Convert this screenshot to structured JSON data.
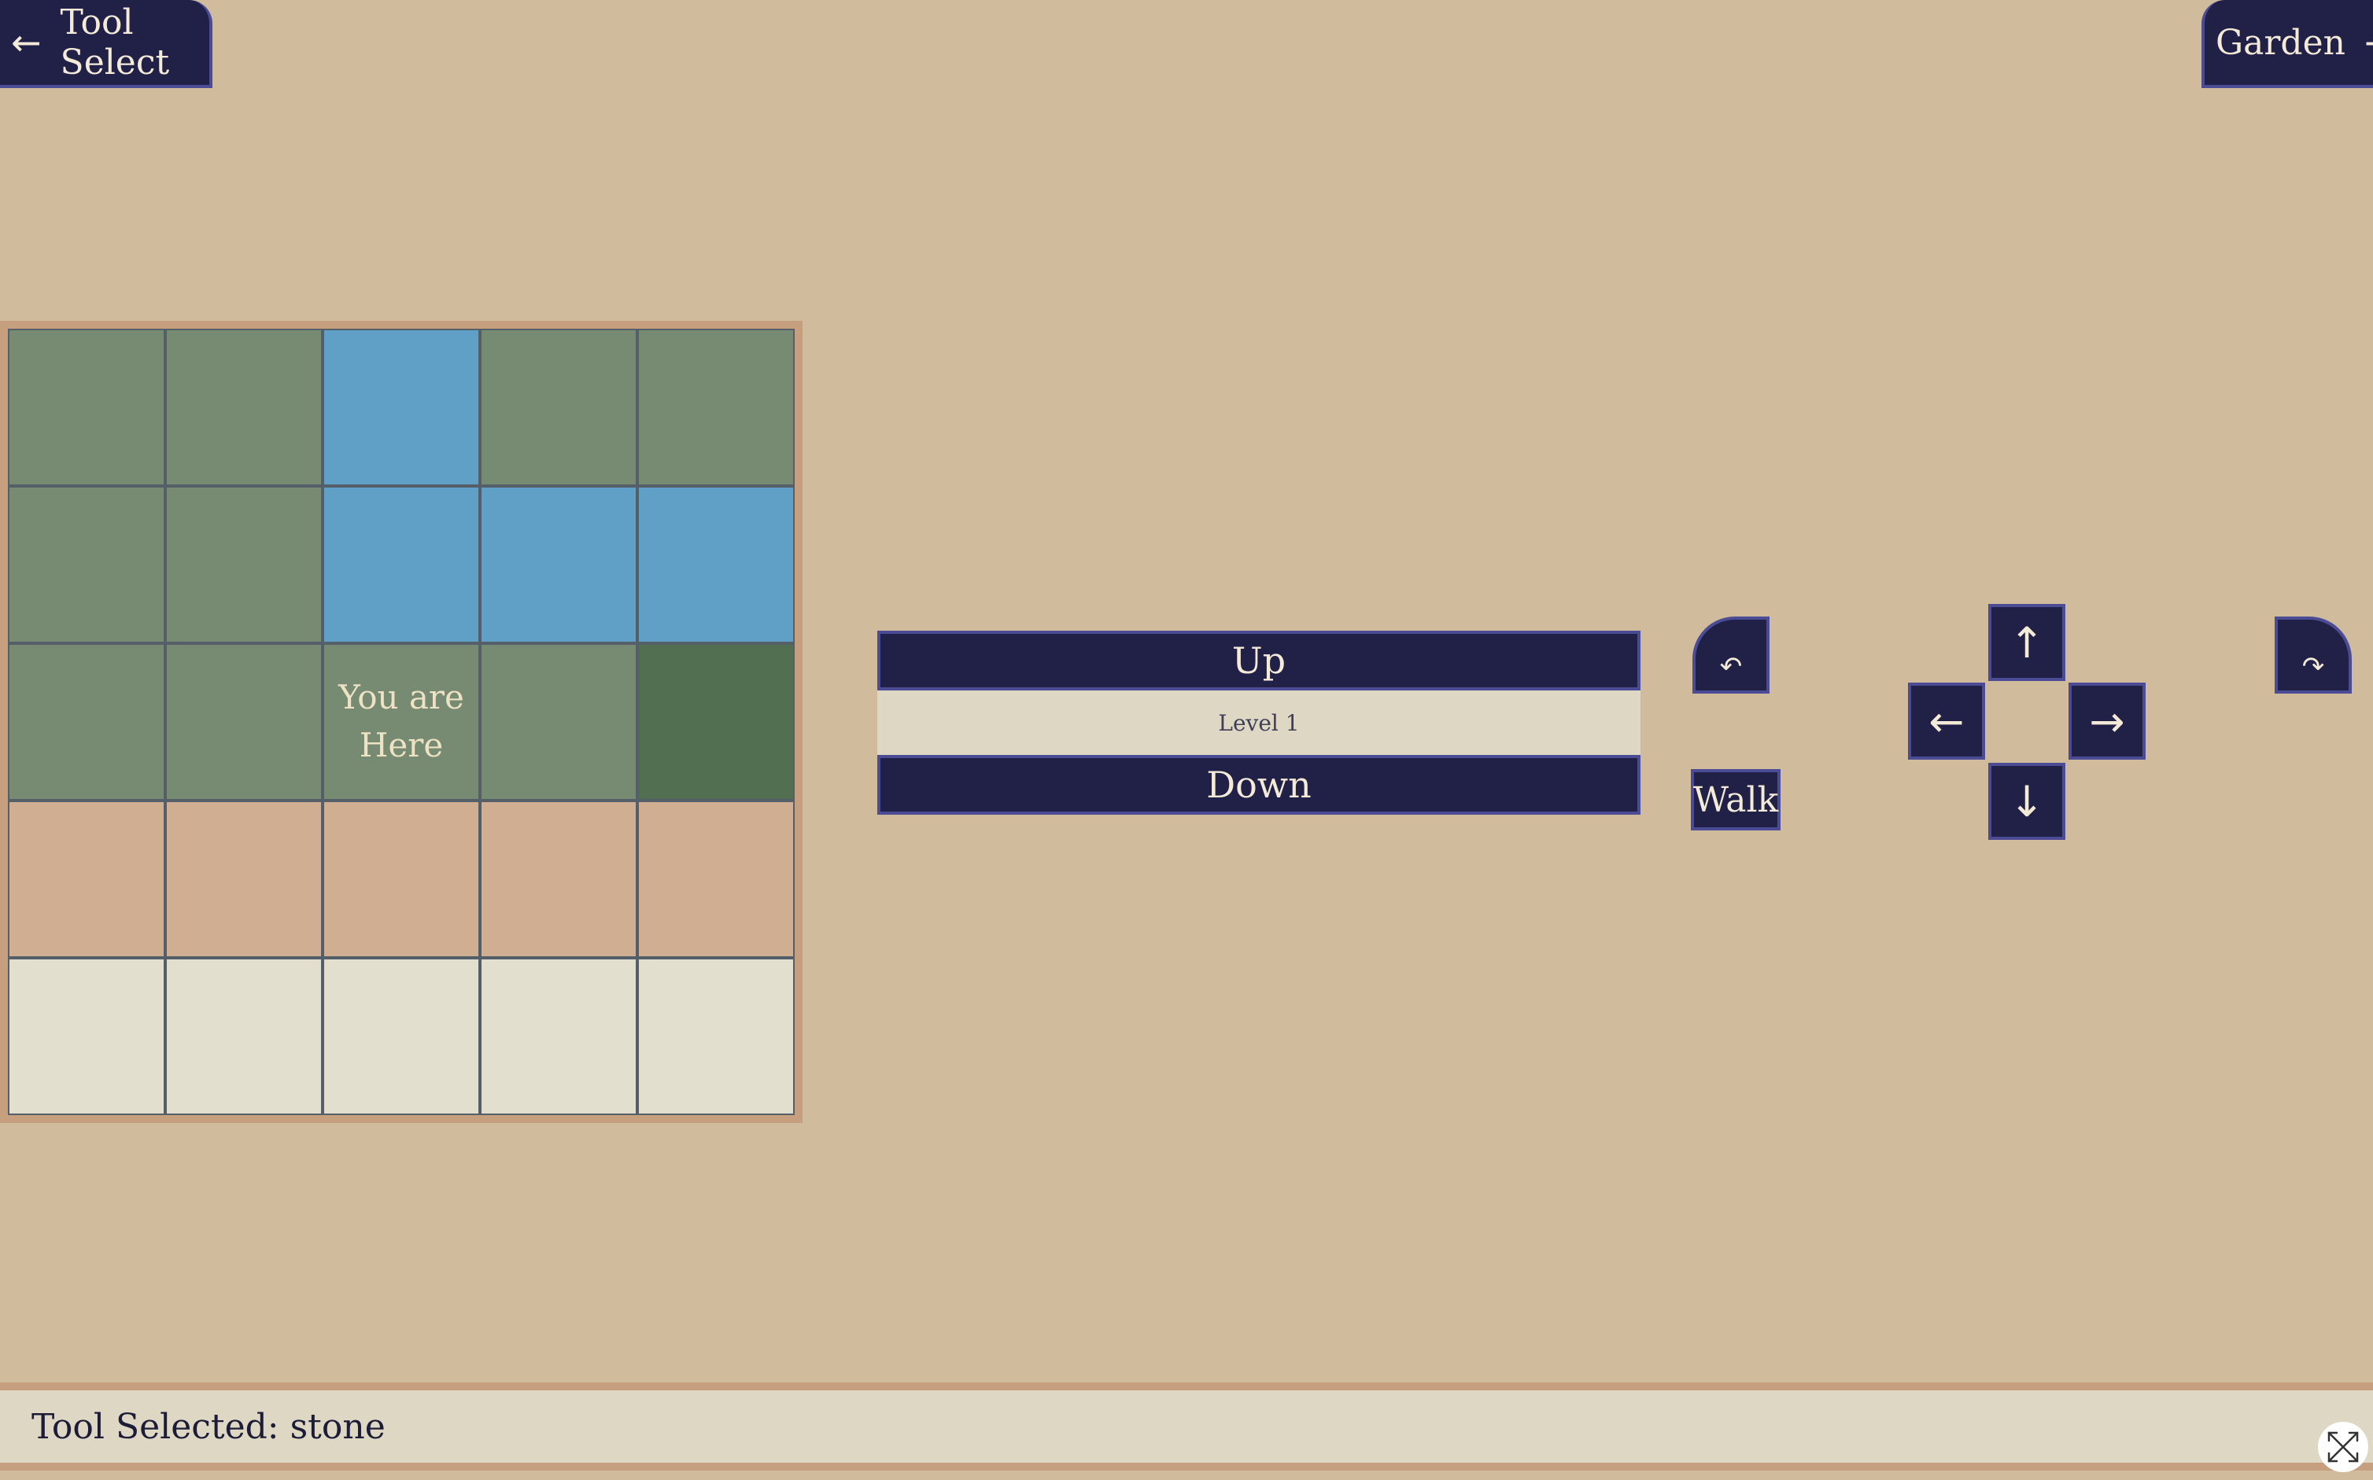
{
  "nav": {
    "back_label": "Tool Select",
    "forward_label": "Garden",
    "back_icon": "arrow-left-icon",
    "forward_icon": "arrow-right-icon"
  },
  "map": {
    "here_label": "You are\nHere",
    "rows": [
      [
        "grass",
        "grass",
        "water",
        "grass",
        "grass"
      ],
      [
        "grass",
        "grass",
        "water",
        "water",
        "water"
      ],
      [
        "grass",
        "grass",
        "here",
        "grass",
        "dark-grass"
      ],
      [
        "dirt",
        "dirt",
        "dirt",
        "dirt",
        "dirt"
      ],
      [
        "stone",
        "stone",
        "stone",
        "stone",
        "stone"
      ]
    ]
  },
  "level": {
    "up_label": "Up",
    "current_label": "Level 1",
    "down_label": "Down"
  },
  "controls": {
    "walk_label": "Walk",
    "rotate_left_glyph": "↶",
    "rotate_right_glyph": "↷",
    "up_glyph": "↑",
    "left_glyph": "←",
    "right_glyph": "→",
    "down_glyph": "↓"
  },
  "status": {
    "text": "Tool Selected: stone"
  },
  "colors": {
    "background": "#d0bc9c",
    "button": "#212046",
    "button_border": "#4c4c96",
    "grass": "#778b72",
    "water": "#60a0c7",
    "dark_grass": "#526f51",
    "dirt": "#cfae92",
    "stone": "#e3dfce"
  }
}
